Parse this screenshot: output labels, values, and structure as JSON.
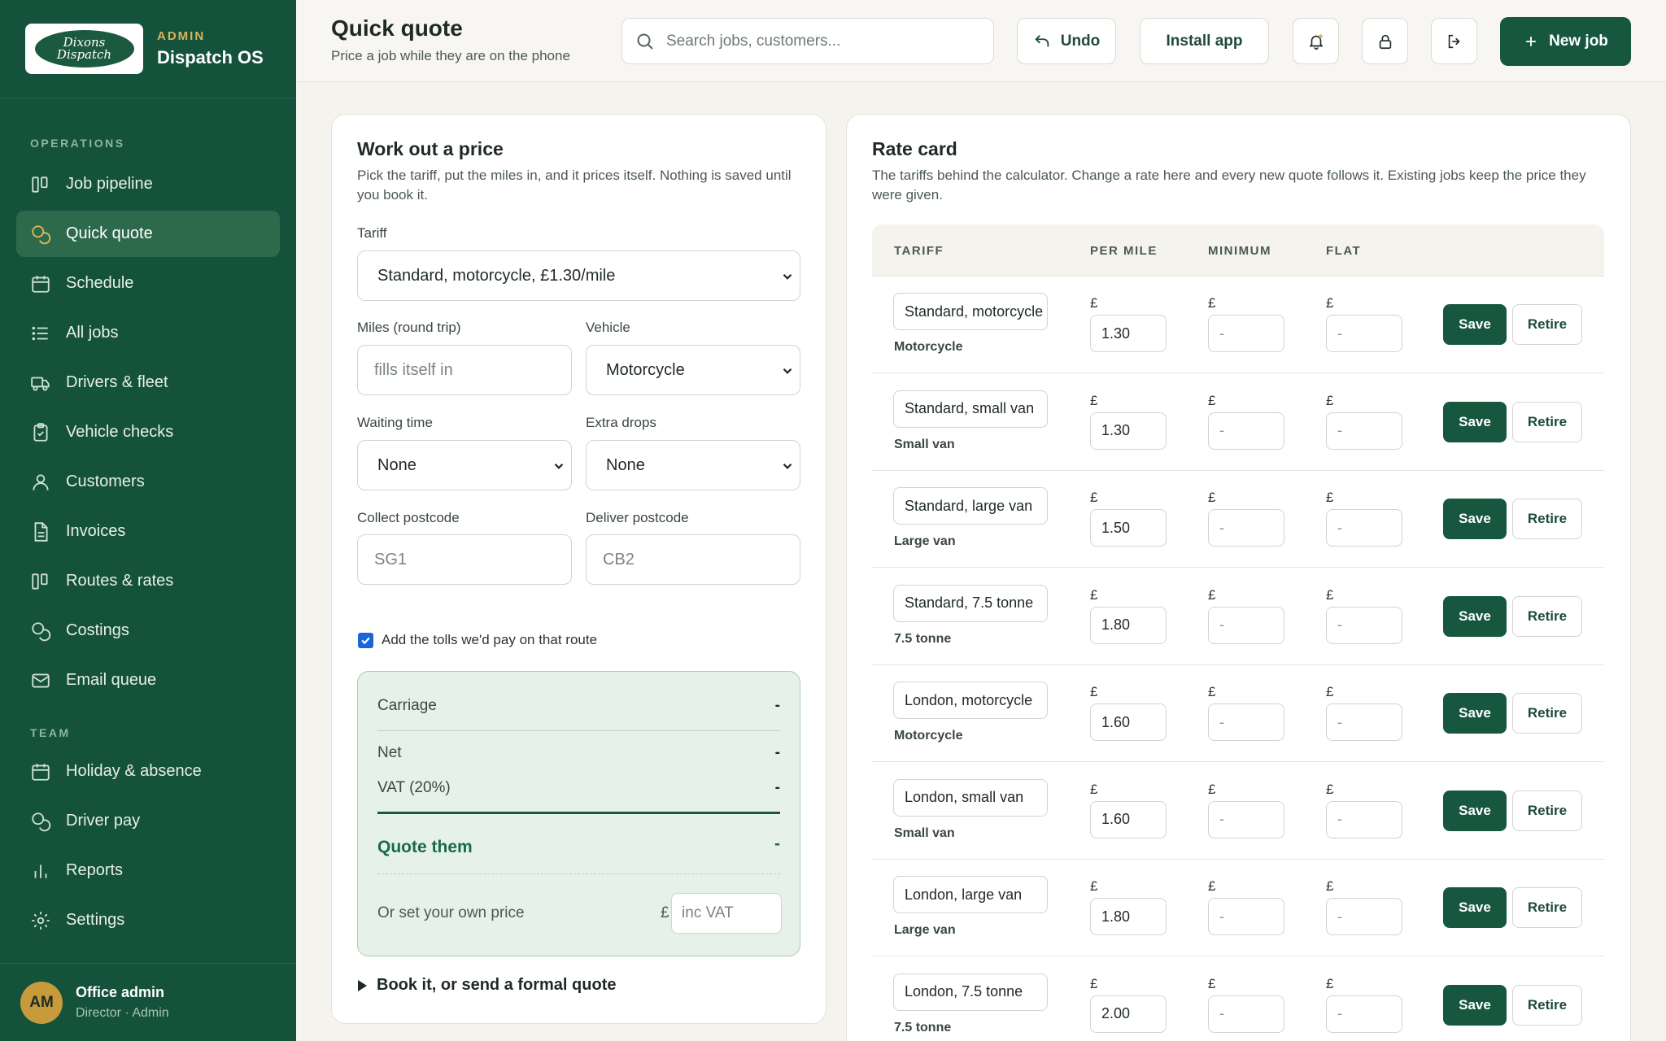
{
  "brand": {
    "logo_text": "Dixons Dispatch",
    "eyebrow": "ADMIN",
    "name": "Dispatch OS"
  },
  "nav": {
    "sections": {
      "operations": "OPERATIONS",
      "team": "TEAM"
    },
    "items": [
      {
        "label": "Job pipeline",
        "icon": "pipeline-icon",
        "active": false
      },
      {
        "label": "Quick quote",
        "icon": "quote-icon",
        "active": true
      },
      {
        "label": "Schedule",
        "icon": "calendar-icon",
        "active": false
      },
      {
        "label": "All jobs",
        "icon": "list-icon",
        "active": false
      },
      {
        "label": "Drivers & fleet",
        "icon": "truck-icon",
        "active": false
      },
      {
        "label": "Vehicle checks",
        "icon": "clipboard-check-icon",
        "active": false
      },
      {
        "label": "Customers",
        "icon": "user-icon",
        "active": false
      },
      {
        "label": "Invoices",
        "icon": "document-icon",
        "active": false
      },
      {
        "label": "Routes & rates",
        "icon": "routes-icon",
        "active": false
      },
      {
        "label": "Costings",
        "icon": "coins-icon",
        "active": false
      },
      {
        "label": "Email queue",
        "icon": "mail-icon",
        "active": false
      },
      {
        "label": "Holiday & absence",
        "icon": "calendar-icon",
        "active": false
      },
      {
        "label": "Driver pay",
        "icon": "coins-icon",
        "active": false
      },
      {
        "label": "Reports",
        "icon": "bar-chart-icon",
        "active": false
      },
      {
        "label": "Settings",
        "icon": "gear-icon",
        "active": false
      }
    ]
  },
  "user": {
    "initials": "AM",
    "name": "Office admin",
    "role": "Director · Admin"
  },
  "header": {
    "title": "Quick quote",
    "subtitle": "Price a job while they are on the phone",
    "search_placeholder": "Search jobs, customers...",
    "undo_label": "Undo",
    "install_label": "Install app",
    "new_job_label": "New job"
  },
  "calculator": {
    "title": "Work out a price",
    "description": "Pick the tariff, put the miles in, and it prices itself. Nothing is saved until you book it.",
    "tariff_label": "Tariff",
    "tariff_value": "Standard, motorcycle, £1.30/mile",
    "miles_label": "Miles (round trip)",
    "miles_placeholder": "fills itself in",
    "vehicle_label": "Vehicle",
    "vehicle_value": "Motorcycle",
    "waiting_label": "Waiting time",
    "waiting_value": "None",
    "drops_label": "Extra drops",
    "drops_value": "None",
    "collect_label": "Collect postcode",
    "collect_placeholder": "SG1",
    "deliver_label": "Deliver postcode",
    "deliver_placeholder": "CB2",
    "tolls_label": "Add the tolls we'd pay on that route",
    "tolls_checked": true,
    "summary": {
      "carriage_label": "Carriage",
      "carriage_value": "-",
      "net_label": "Net",
      "net_value": "-",
      "vat_label": "VAT (20%)",
      "vat_value": "-",
      "quote_label": "Quote them",
      "quote_value": "-",
      "own_price_label": "Or set your own price",
      "currency": "£",
      "own_price_placeholder": "inc VAT"
    },
    "book_label": "Book it, or send a formal quote"
  },
  "rate_card": {
    "title": "Rate card",
    "description": "The tariffs behind the calculator. Change a rate here and every new quote follows it. Existing jobs keep the price they were given.",
    "headers": {
      "tariff": "TARIFF",
      "per_mile": "PER MILE",
      "minimum": "MINIMUM",
      "flat": "FLAT"
    },
    "currency": "£",
    "empty_placeholder": "-",
    "save_label": "Save",
    "retire_label": "Retire",
    "rows": [
      {
        "name": "Standard, motorcycle",
        "vehicle": "Motorcycle",
        "per_mile": "1.30"
      },
      {
        "name": "Standard, small van",
        "vehicle": "Small van",
        "per_mile": "1.30"
      },
      {
        "name": "Standard, large van",
        "vehicle": "Large van",
        "per_mile": "1.50"
      },
      {
        "name": "Standard, 7.5 tonne",
        "vehicle": "7.5 tonne",
        "per_mile": "1.80"
      },
      {
        "name": "London, motorcycle",
        "vehicle": "Motorcycle",
        "per_mile": "1.60"
      },
      {
        "name": "London, small van",
        "vehicle": "Small van",
        "per_mile": "1.60"
      },
      {
        "name": "London, large van",
        "vehicle": "Large van",
        "per_mile": "1.80"
      },
      {
        "name": "London, 7.5 tonne",
        "vehicle": "7.5 tonne",
        "per_mile": "2.00"
      }
    ]
  },
  "colors": {
    "sidebar": "#14523c",
    "accent": "#17573f",
    "gold": "#d9b45a",
    "summary_bg": "#e6f1ea"
  }
}
